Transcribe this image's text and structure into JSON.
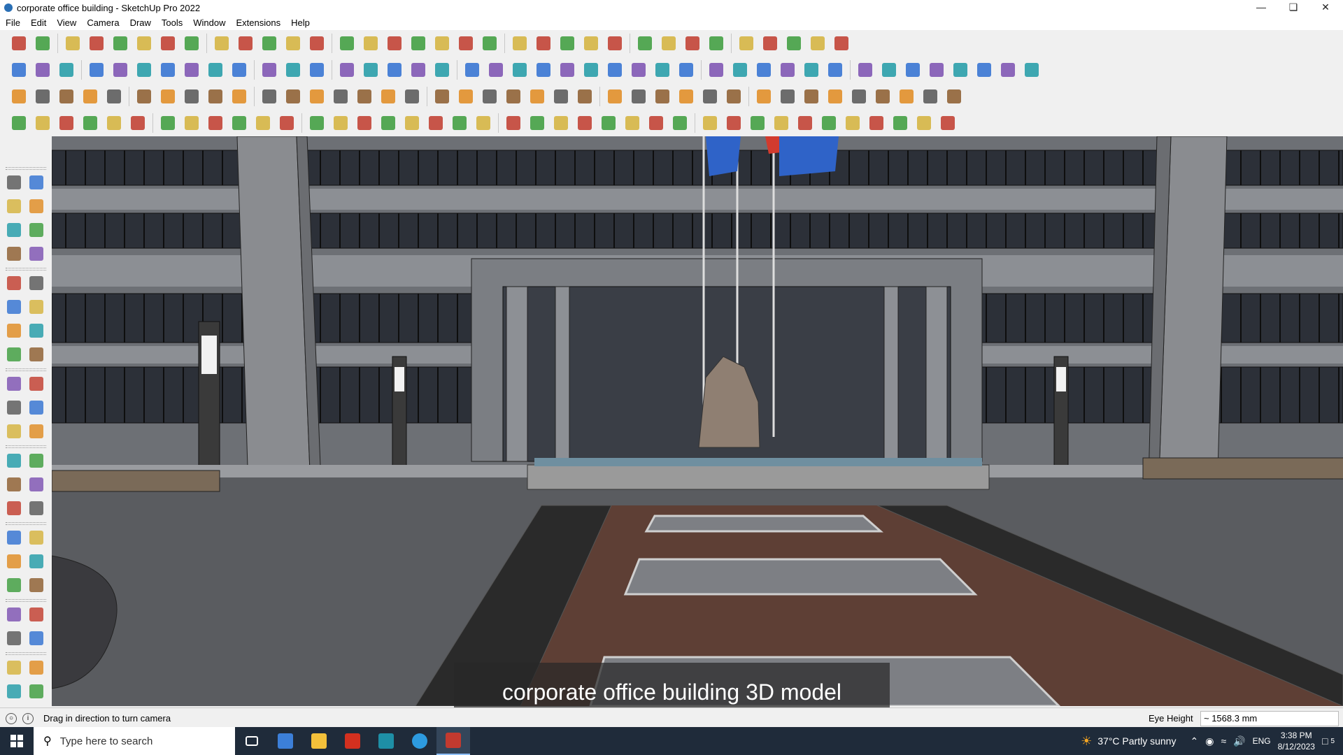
{
  "window": {
    "title": "corporate office building - SketchUp Pro 2022",
    "controls": [
      "minimize-icon",
      "maximize-icon",
      "close-icon"
    ]
  },
  "menu": [
    "File",
    "Edit",
    "View",
    "Camera",
    "Draw",
    "Tools",
    "Window",
    "Extensions",
    "Help"
  ],
  "statusbar": {
    "hint": "Drag in direction to turn camera",
    "eye_height_label": "Eye Height",
    "eye_height_value": "~ 1568.3 mm"
  },
  "caption": "corporate office building 3D model",
  "taskbar": {
    "search_placeholder": "Type here to search",
    "weather": "37°C  Partly sunny",
    "language": "ENG",
    "time": "3:38 PM",
    "date": "8/12/2023",
    "notification_count": "5"
  },
  "colors": {
    "accent_red": "#d23b2e",
    "accent_blue": "#2f63c8",
    "taskbar": "#1f2b3a"
  }
}
